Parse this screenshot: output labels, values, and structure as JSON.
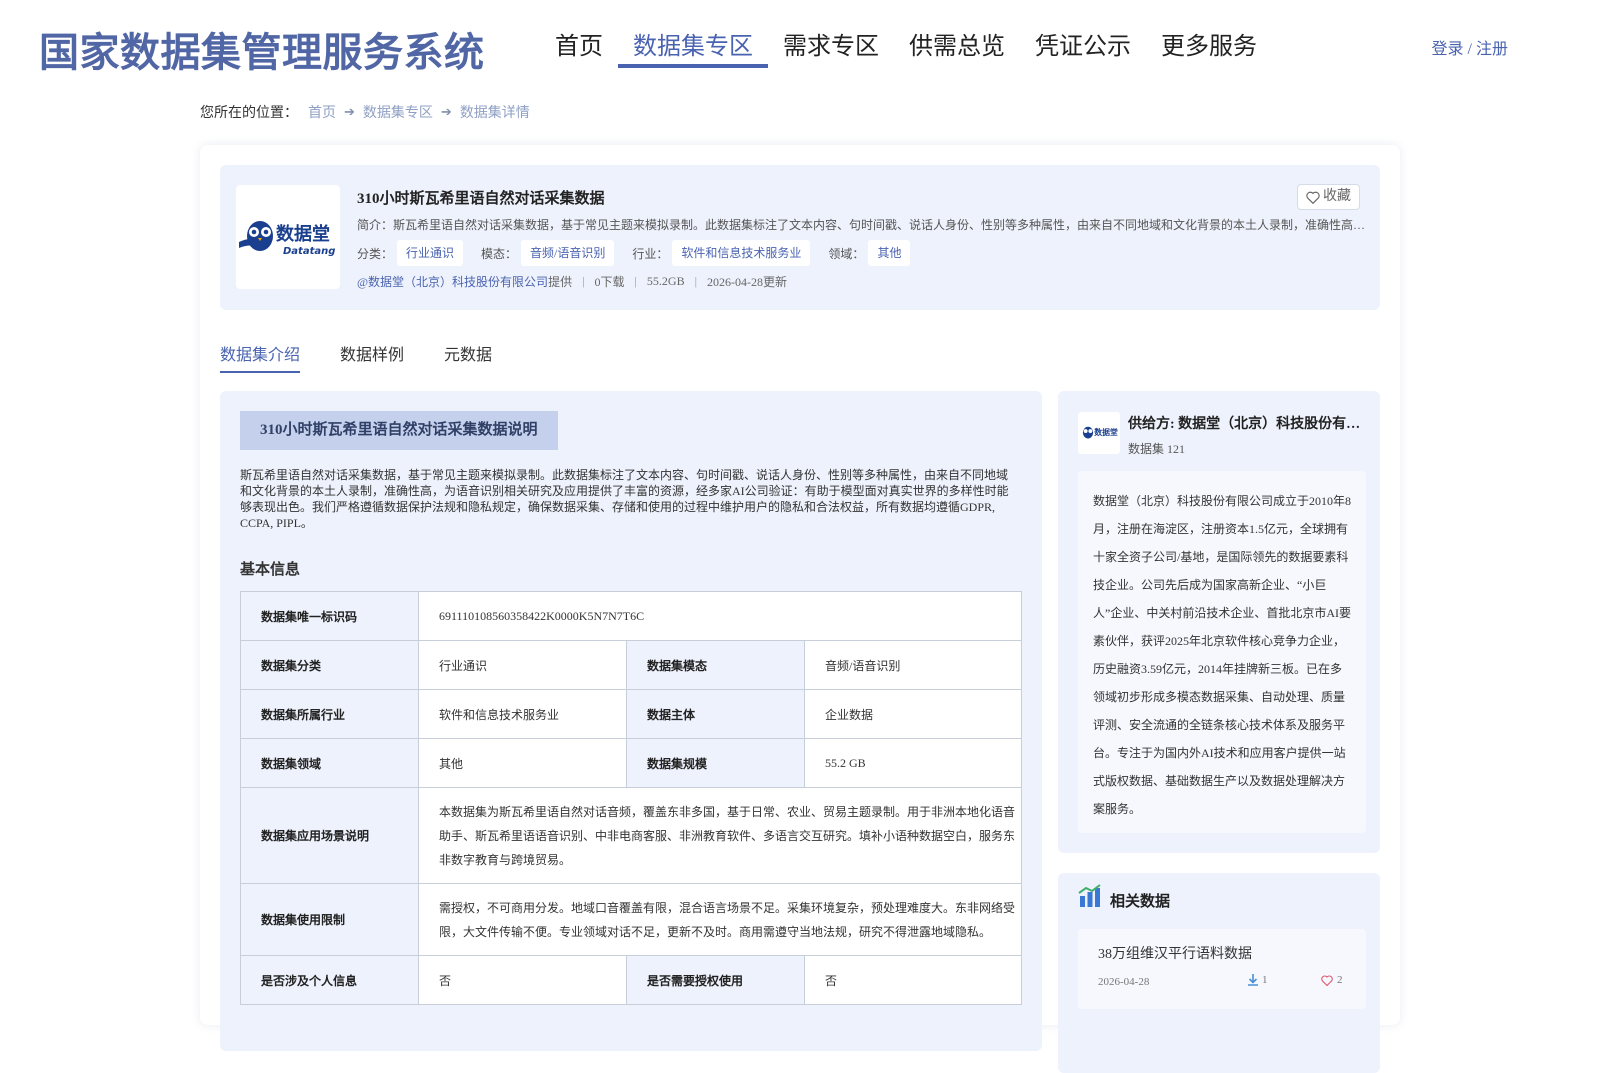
{
  "header": {
    "site_title": "国家数据集管理服务系统",
    "nav": [
      "首页",
      "数据集专区",
      "需求专区",
      "供需总览",
      "凭证公示",
      "更多服务"
    ],
    "active_nav": 1,
    "login": "登录 / 注册"
  },
  "breadcrumb": {
    "prefix": "您所在的位置：",
    "items": [
      "首页",
      "数据集专区",
      "数据集详情"
    ]
  },
  "dataset": {
    "logo_text": "数据堂",
    "logo_sub": "Datatang",
    "title": "310小时斯瓦希里语自然对话采集数据",
    "favorite": "收藏",
    "desc": "简介：斯瓦希里语自然对话采集数据，基于常见主题来模拟录制。此数据集标注了文本内容、句时间戳、说话人身份、性别等多种属性，由来自不同地域和文化背景的本土人录制，准确性高，为语音识别相关研究及应用提供了丰富的资源，经多家AI公司验证：有助于模型面对真实世界的多样性时能够表现出色。",
    "tags": {
      "category_label": "分类：",
      "category": "行业通识",
      "modality_label": "模态：",
      "modality": "音频/语音识别",
      "industry_label": "行业：",
      "industry": "软件和信息技术服务业",
      "domain_label": "领域：",
      "domain": "其他"
    },
    "meta": {
      "provider": "@数据堂（北京）科技股份有限公司",
      "provider_suffix": "提供",
      "downloads": "0下载",
      "size": "55.2GB",
      "updated": "2026-04-28更新"
    }
  },
  "tabs": [
    "数据集介绍",
    "数据样例",
    "元数据"
  ],
  "intro": {
    "section_title": "310小时斯瓦希里语自然对话采集数据说明",
    "text": "斯瓦希里语自然对话采集数据，基于常见主题来模拟录制。此数据集标注了文本内容、句时间戳、说话人身份、性别等多种属性，由来自不同地域和文化背景的本土人录制，准确性高，为语音识别相关研究及应用提供了丰富的资源，经多家AI公司验证：有助于模型面对真实世界的多样性时能够表现出色。我们严格遵循数据保护法规和隐私规定，确保数据采集、存储和使用的过程中维护用户的隐私和合法权益，所有数据均遵循GDPR, CCPA, PIPL。",
    "basic_title": "基本信息"
  },
  "basic_info": {
    "uid_label": "数据集唯一标识码",
    "uid": "691110108560358422K0000K5N7N7T6C",
    "category_label": "数据集分类",
    "category": "行业通识",
    "modality_label": "数据集模态",
    "modality": "音频/语音识别",
    "industry_label": "数据集所属行业",
    "industry": "软件和信息技术服务业",
    "subject_label": "数据主体",
    "subject": "企业数据",
    "domain_label": "数据集领域",
    "domain": "其他",
    "scale_label": "数据集规模",
    "scale": "55.2 GB",
    "scenario_label": "数据集应用场景说明",
    "scenario": "本数据集为斯瓦希里语自然对话音频，覆盖东非多国，基于日常、农业、贸易主题录制。用于非洲本地化语音助手、斯瓦希里语语音识别、中非电商客服、非洲教育软件、多语言交互研究。填补小语种数据空白，服务东非数字教育与跨境贸易。",
    "limit_label": "数据集使用限制",
    "limit": "需授权，不可商用分发。地域口音覆盖有限，混合语言场景不足。采集环境复杂，预处理难度大。东非网络受限，大文件传输不便。专业领域对话不足，更新不及时。商用需遵守当地法规，研究不得泄露地域隐私。",
    "personal_label": "是否涉及个人信息",
    "personal": "否",
    "auth_label": "是否需要授权使用",
    "auth": "否"
  },
  "provider": {
    "name": "供给方: 数据堂（北京）科技股份有限公司",
    "count": "数据集 121",
    "desc": "数据堂（北京）科技股份有限公司成立于2010年8月，注册在海淀区，注册资本1.5亿元，全球拥有十家全资子公司/基地，是国际领先的数据要素科技企业。公司先后成为国家高新企业、“小巨人”企业、中关村前沿技术企业、首批北京市AI要素伙伴，获评2025年北京软件核心竞争力企业，历史融资3.59亿元，2014年挂牌新三板。已在多领域初步形成多模态数据采集、自动处理、质量评测、安全流通的全链条核心技术体系及服务平台。专注于为国内外AI技术和应用客户提供一站式版权数据、基础数据生产以及数据处理解决方案服务。"
  },
  "related": {
    "title": "相关数据",
    "items": [
      {
        "title": "38万组维汉平行语料数据",
        "date": "2026-04-28",
        "downloads": "1",
        "likes": "2"
      }
    ]
  },
  "colors": {
    "accent": "#4a63b0",
    "panel": "#eef2fc",
    "title": "#5166a5"
  }
}
